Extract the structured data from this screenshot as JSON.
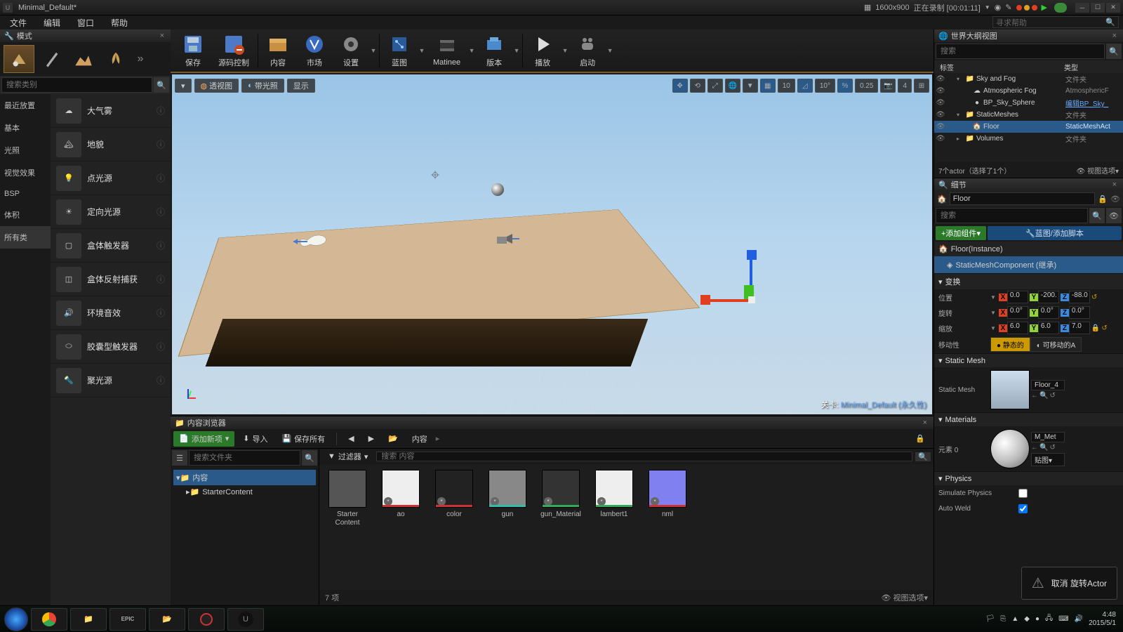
{
  "window": {
    "title": "Minimal_Default*",
    "resolution": "1600x900",
    "recording": "正在录制 [00:01:11]",
    "help_search_placeholder": "寻求帮助"
  },
  "menubar": [
    "文件",
    "编辑",
    "窗口",
    "帮助"
  ],
  "modes": {
    "panel_title": "模式",
    "search_placeholder": "搜索类别",
    "categories": [
      "最近放置",
      "基本",
      "光照",
      "视觉效果",
      "BSP",
      "体积",
      "所有类"
    ],
    "active_category": 6,
    "items": [
      "大气雾",
      "地貌",
      "点光源",
      "定向光源",
      "盒体触发器",
      "盒体反射捕获",
      "环境音效",
      "胶囊型触发器",
      "聚光源"
    ]
  },
  "toolbar": {
    "save": "保存",
    "source": "源码控制",
    "content": "内容",
    "market": "市场",
    "settings": "设置",
    "blueprint": "蓝图",
    "matinee": "Matinee",
    "version": "版本",
    "play": "播放",
    "launch": "启动"
  },
  "viewport": {
    "dropdown": "",
    "perspective": "透视图",
    "lit": "带光照",
    "show": "显示",
    "snap_pos": "10",
    "snap_rot": "10°",
    "snap_scale": "0.25",
    "cam_speed": "4",
    "level_label_prefix": "关卡:",
    "level_name": "Minimal_Default (永久性)"
  },
  "content_browser": {
    "tab": "内容浏览器",
    "add_new": "添加新项",
    "import": "导入",
    "save_all": "保存所有",
    "path": "内容",
    "search_folders": "搜索文件夹",
    "filters": "过滤器",
    "search_assets": "搜索 内容",
    "tree_root": "内容",
    "tree_child": "StarterContent",
    "assets": [
      {
        "name": "Starter Content",
        "color": "#555"
      },
      {
        "name": "ao",
        "color": "#eee",
        "bar": "#cc3333"
      },
      {
        "name": "color",
        "color": "#222",
        "bar": "#cc3333"
      },
      {
        "name": "gun",
        "color": "#888",
        "bar": "#33bbaa"
      },
      {
        "name": "gun_Material",
        "color": "#333",
        "bar": "#33aa55"
      },
      {
        "name": "lambert1",
        "color": "#eee",
        "bar": "#33aa55"
      },
      {
        "name": "nml",
        "color": "#8080f0",
        "bar": "#cc3333"
      }
    ],
    "footer_count": "7 项",
    "view_options": "视图选项"
  },
  "outliner": {
    "panel_title": "世界大纲视图",
    "search": "搜索",
    "col_label": "标签",
    "col_type": "类型",
    "rows": [
      {
        "indent": 1,
        "arrow": "▾",
        "icon": "folder",
        "label": "Sky and Fog",
        "type": "文件夹"
      },
      {
        "indent": 2,
        "arrow": "",
        "icon": "actor",
        "label": "Atmospheric Fog",
        "type": "AtmosphericF"
      },
      {
        "indent": 2,
        "arrow": "",
        "icon": "bp",
        "label": "BP_Sky_Sphere",
        "type": "编辑BP_Sky_",
        "link": true
      },
      {
        "indent": 1,
        "arrow": "▾",
        "icon": "folder",
        "label": "StaticMeshes",
        "type": "文件夹"
      },
      {
        "indent": 2,
        "arrow": "",
        "icon": "mesh",
        "label": "Floor",
        "type": "StaticMeshAct",
        "sel": true
      },
      {
        "indent": 1,
        "arrow": "▸",
        "icon": "folder",
        "label": "Volumes",
        "type": "文件夹"
      }
    ],
    "footer": "7个actor（选择了1个）",
    "view_options": "视图选项"
  },
  "details": {
    "panel_title": "细节",
    "name": "Floor",
    "search": "搜索",
    "add_component": "+添加组件",
    "blueprint_script": "蓝图/添加脚本",
    "root_component": "Floor(Instance)",
    "child_component": "StaticMeshComponent (继承)",
    "cat_transform": "变换",
    "position": "位置",
    "rotation": "旋转",
    "scale": "缩放",
    "mobility": "移动性",
    "pos": {
      "x": "0.0",
      "y": "-200.",
      "z": "-88.0"
    },
    "rot": {
      "x": "0.0°",
      "y": "0.0°",
      "z": "0.0°"
    },
    "scl": {
      "x": "6.0",
      "y": "6.0",
      "z": "7.0"
    },
    "mob_static": "静态的",
    "mob_movable": "可移动的A",
    "cat_staticmesh": "Static Mesh",
    "static_mesh_label": "Static Mesh",
    "static_mesh_value": "Floor_4",
    "cat_materials": "Materials",
    "element0": "元素 0",
    "material_value": "M_Met",
    "texture_dropdown": "贴图",
    "cat_physics": "Physics",
    "simulate_physics": "Simulate Physics",
    "auto_weld": "Auto Weld"
  },
  "toast": {
    "message": "取消 旋转Actor"
  },
  "taskbar": {
    "time": "4:48",
    "date": "2015/5/1"
  }
}
